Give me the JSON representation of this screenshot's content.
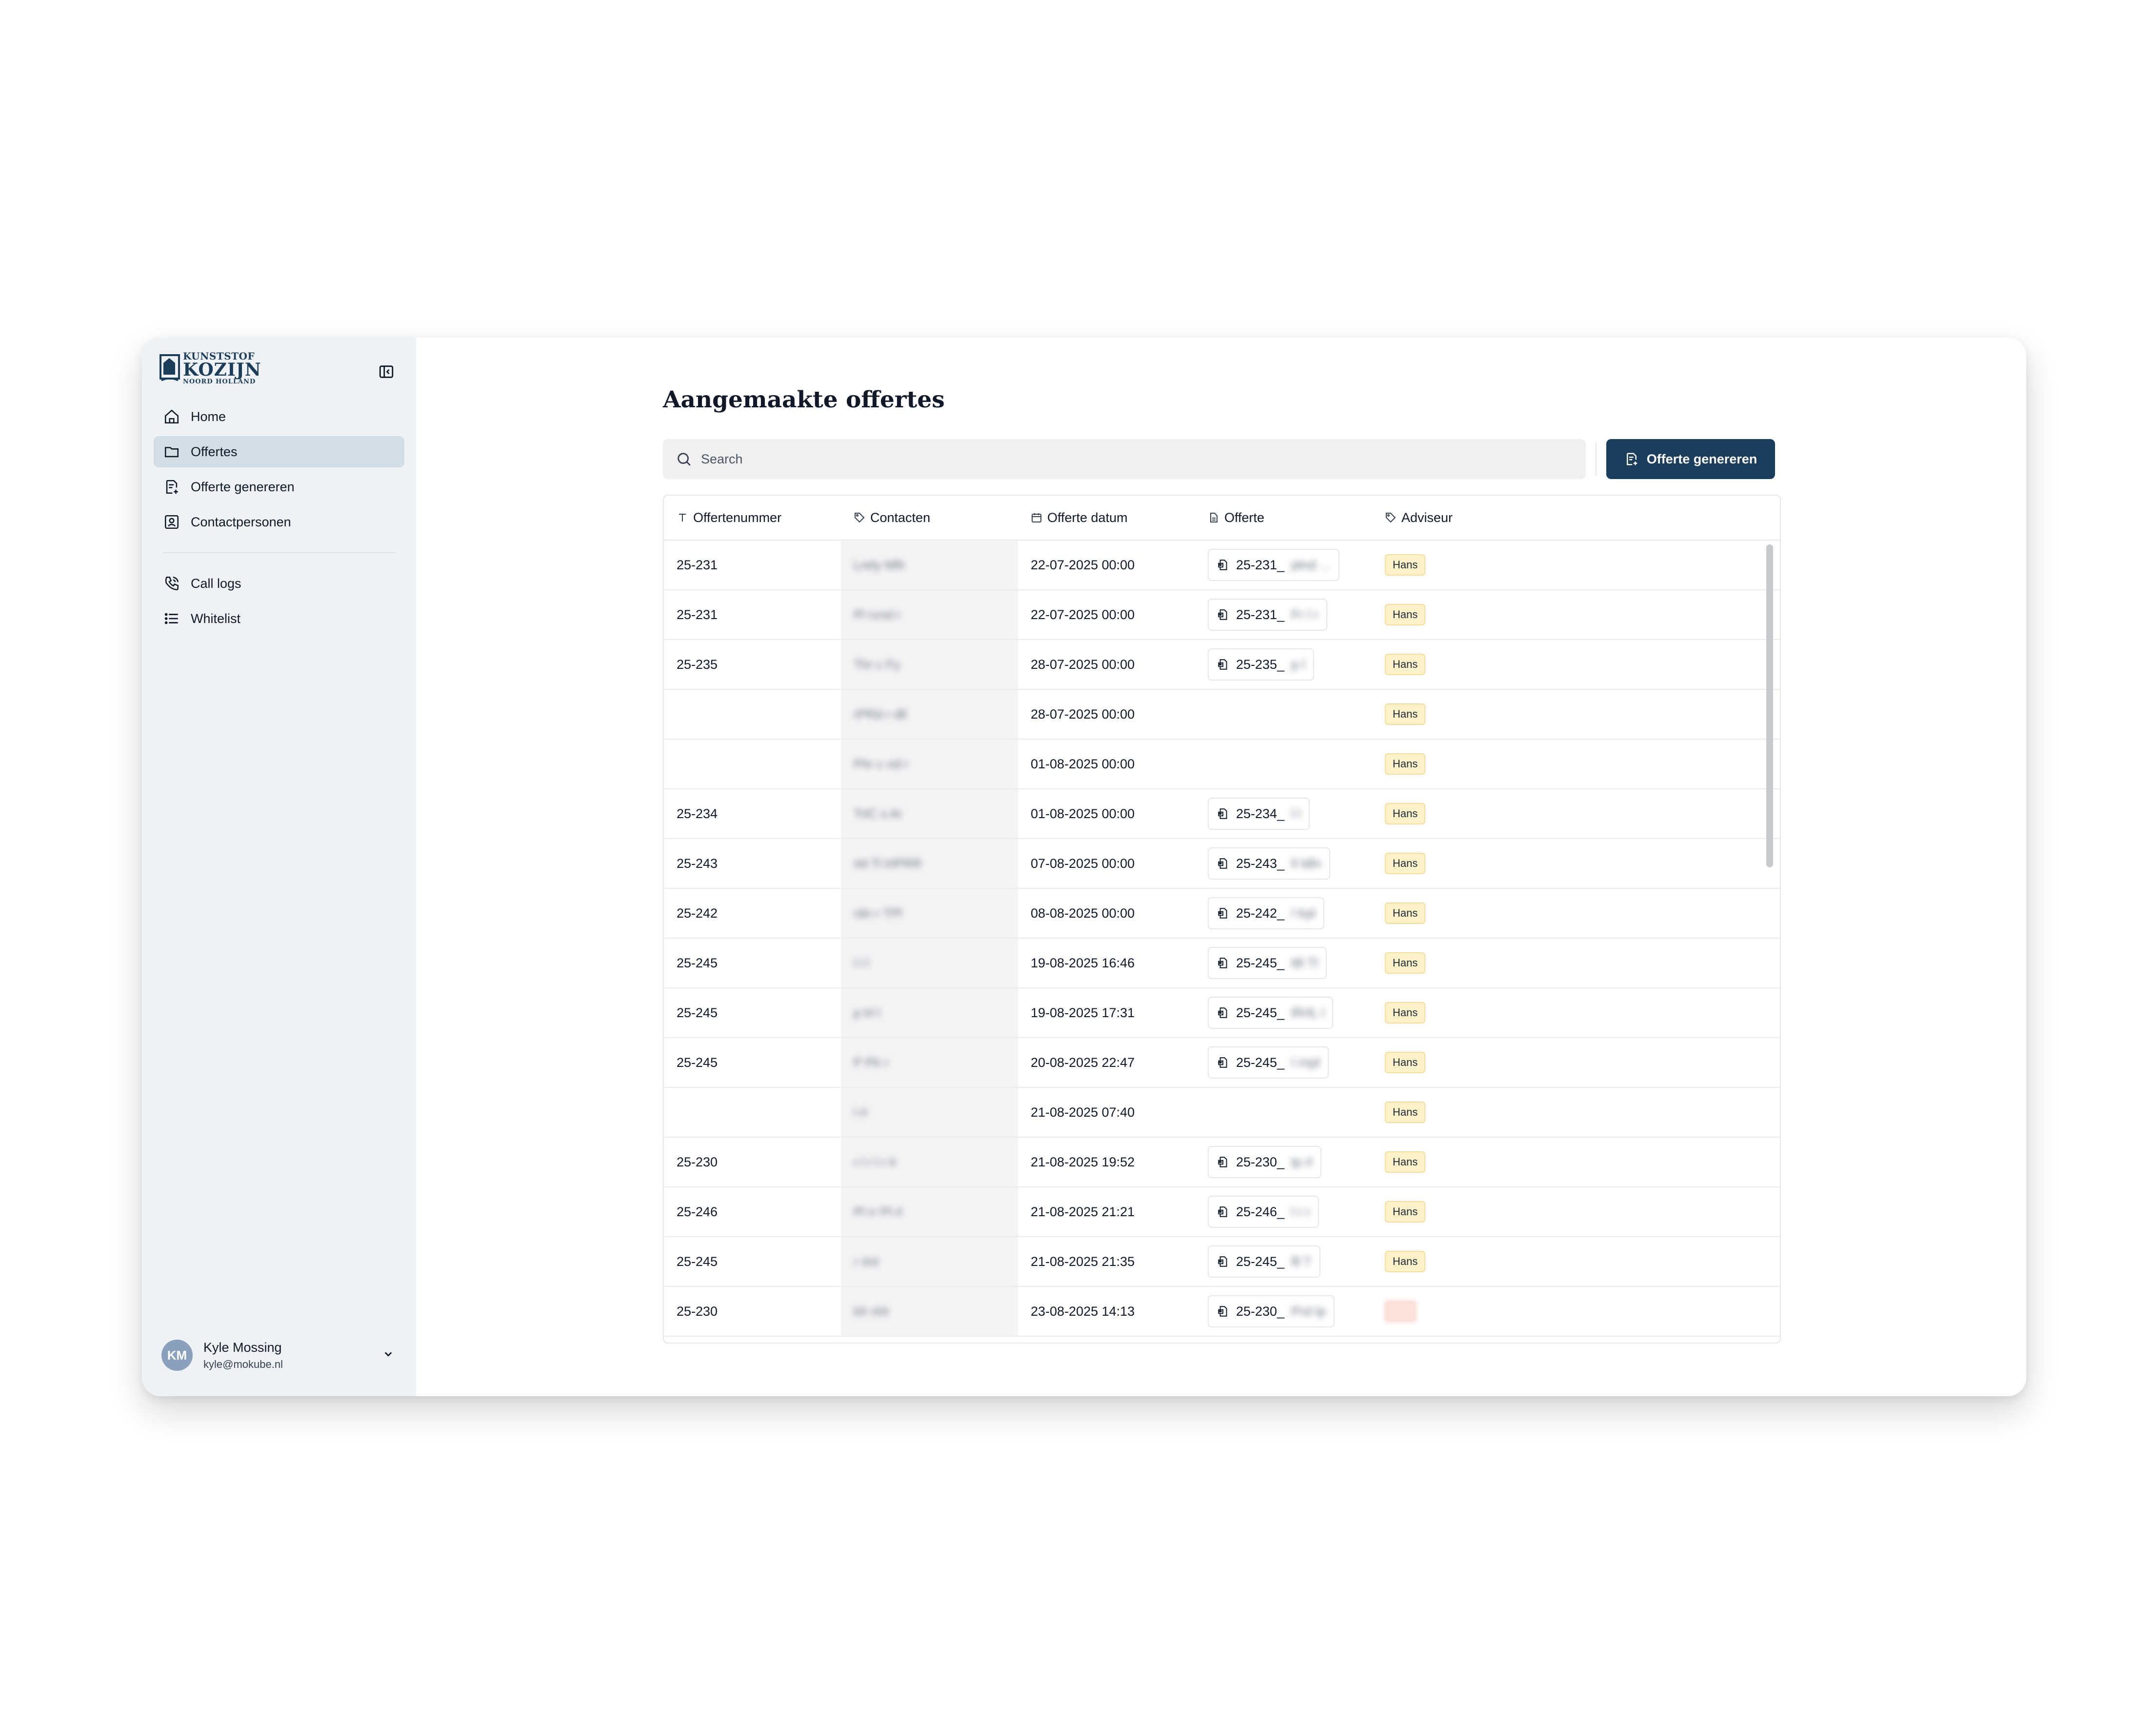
{
  "brand": {
    "logo_line1": "KUNSTSTOF",
    "logo_line2": "KOZIJN",
    "logo_line3": "NOORD HOLLAND",
    "primary_color": "#1b3d5c",
    "sidebar_bg": "#eef2f5"
  },
  "sidebar": {
    "collapse_icon": "sidebar-collapse-icon",
    "main_items": [
      {
        "label": "Home",
        "icon": "home-icon"
      },
      {
        "label": "Offertes",
        "icon": "folder-icon",
        "active": true
      },
      {
        "label": "Offerte genereren",
        "icon": "document-plus-icon"
      },
      {
        "label": "Contactpersonen",
        "icon": "contact-card-icon"
      }
    ],
    "secondary_items": [
      {
        "label": "Call logs",
        "icon": "phone-icon"
      },
      {
        "label": "Whitelist",
        "icon": "list-icon"
      }
    ]
  },
  "user": {
    "initials": "KM",
    "name": "Kyle Mossing",
    "email": "kyle@mokube.nl"
  },
  "page": {
    "title": "Aangemaakte offertes",
    "search_placeholder": "Search",
    "generate_button": "Offerte genereren"
  },
  "table": {
    "headers": [
      "Offertenummer",
      "Contacten",
      "Offerte datum",
      "Offerte",
      "Adviseur"
    ],
    "rows": [
      {
        "nummer": "25-231",
        "contact": "Lrely Mlh",
        "datum": "22-07-2025 00:00",
        "offerte": "25-231_",
        "offerte_tail": "plnd ...",
        "adviseur": "Hans"
      },
      {
        "nummer": "25-231",
        "contact": "Pl rcnd r",
        "datum": "22-07-2025 00:00",
        "offerte": "25-231_",
        "offerte_tail": "Fr l r",
        "adviseur": "Hans"
      },
      {
        "nummer": "25-235",
        "contact": "Thr c Fy",
        "datum": "28-07-2025 00:00",
        "offerte": "25-235_",
        "offerte_tail": "p l",
        "adviseur": "Hans"
      },
      {
        "nummer": "",
        "contact": "rPRd r dll",
        "datum": "28-07-2025 00:00",
        "offerte": "",
        "offerte_tail": "",
        "adviseur": "Hans"
      },
      {
        "nummer": "",
        "contact": "Phr c nd r",
        "datum": "01-08-2025 00:00",
        "offerte": "",
        "offerte_tail": "",
        "adviseur": "Hans"
      },
      {
        "nummer": "25-234",
        "contact": "TrlC s Ar",
        "datum": "01-08-2025 00:00",
        "offerte": "25-234_",
        "offerte_tail": "l l",
        "adviseur": "Hans"
      },
      {
        "nummer": "25-243",
        "contact": "rld Tl lrlPRR",
        "datum": "07-08-2025 00:00",
        "offerte": "25-243_",
        "offerte_tail": "ll ldln",
        "adviseur": "Hans"
      },
      {
        "nummer": "25-242",
        "contact": "rdn r TPl",
        "datum": "08-08-2025 00:00",
        "offerte": "25-242_",
        "offerte_tail": "l lrpl",
        "adviseur": "Hans"
      },
      {
        "nummer": "25-245",
        "contact": "l l l",
        "datum": "19-08-2025 16:46",
        "offerte": "25-245_",
        "offerte_tail": "ltll Tl",
        "adviseur": "Hans"
      },
      {
        "nummer": "25-245",
        "contact": "p lrl l",
        "datum": "19-08-2025 17:31",
        "offerte": "25-245_",
        "offerte_tail": "lRrlL l",
        "adviseur": "Hans"
      },
      {
        "nummer": "25-245",
        "contact": "P Plr r",
        "datum": "20-08-2025 22:47",
        "offerte": "25-245_",
        "offerte_tail": "l rnpl",
        "adviseur": "Hans"
      },
      {
        "nummer": "",
        "contact": "l rl",
        "datum": "21-08-2025 07:40",
        "offerte": "",
        "offerte_tail": "",
        "adviseur": "Hans"
      },
      {
        "nummer": "25-230",
        "contact": "r l r l r lr",
        "datum": "21-08-2025 19:52",
        "offerte": "25-230_",
        "offerte_tail": "lp rl",
        "adviseur": "Hans"
      },
      {
        "nummer": "25-246",
        "contact": "Pl rr Pl rl",
        "datum": "21-08-2025 21:21",
        "offerte": "25-246_",
        "offerte_tail": "l r r",
        "adviseur": "Hans"
      },
      {
        "nummer": "25-245",
        "contact": "r rlnl",
        "datum": "21-08-2025 21:35",
        "offerte": "25-245_",
        "offerte_tail": "lll T",
        "adviseur": "Hans"
      },
      {
        "nummer": "25-230",
        "contact": "lrlr rlrlr",
        "datum": "23-08-2025 14:13",
        "offerte": "25-230_",
        "offerte_tail": "Prd lp",
        "adviseur": "RR",
        "adviseur_color": "red"
      }
    ]
  }
}
